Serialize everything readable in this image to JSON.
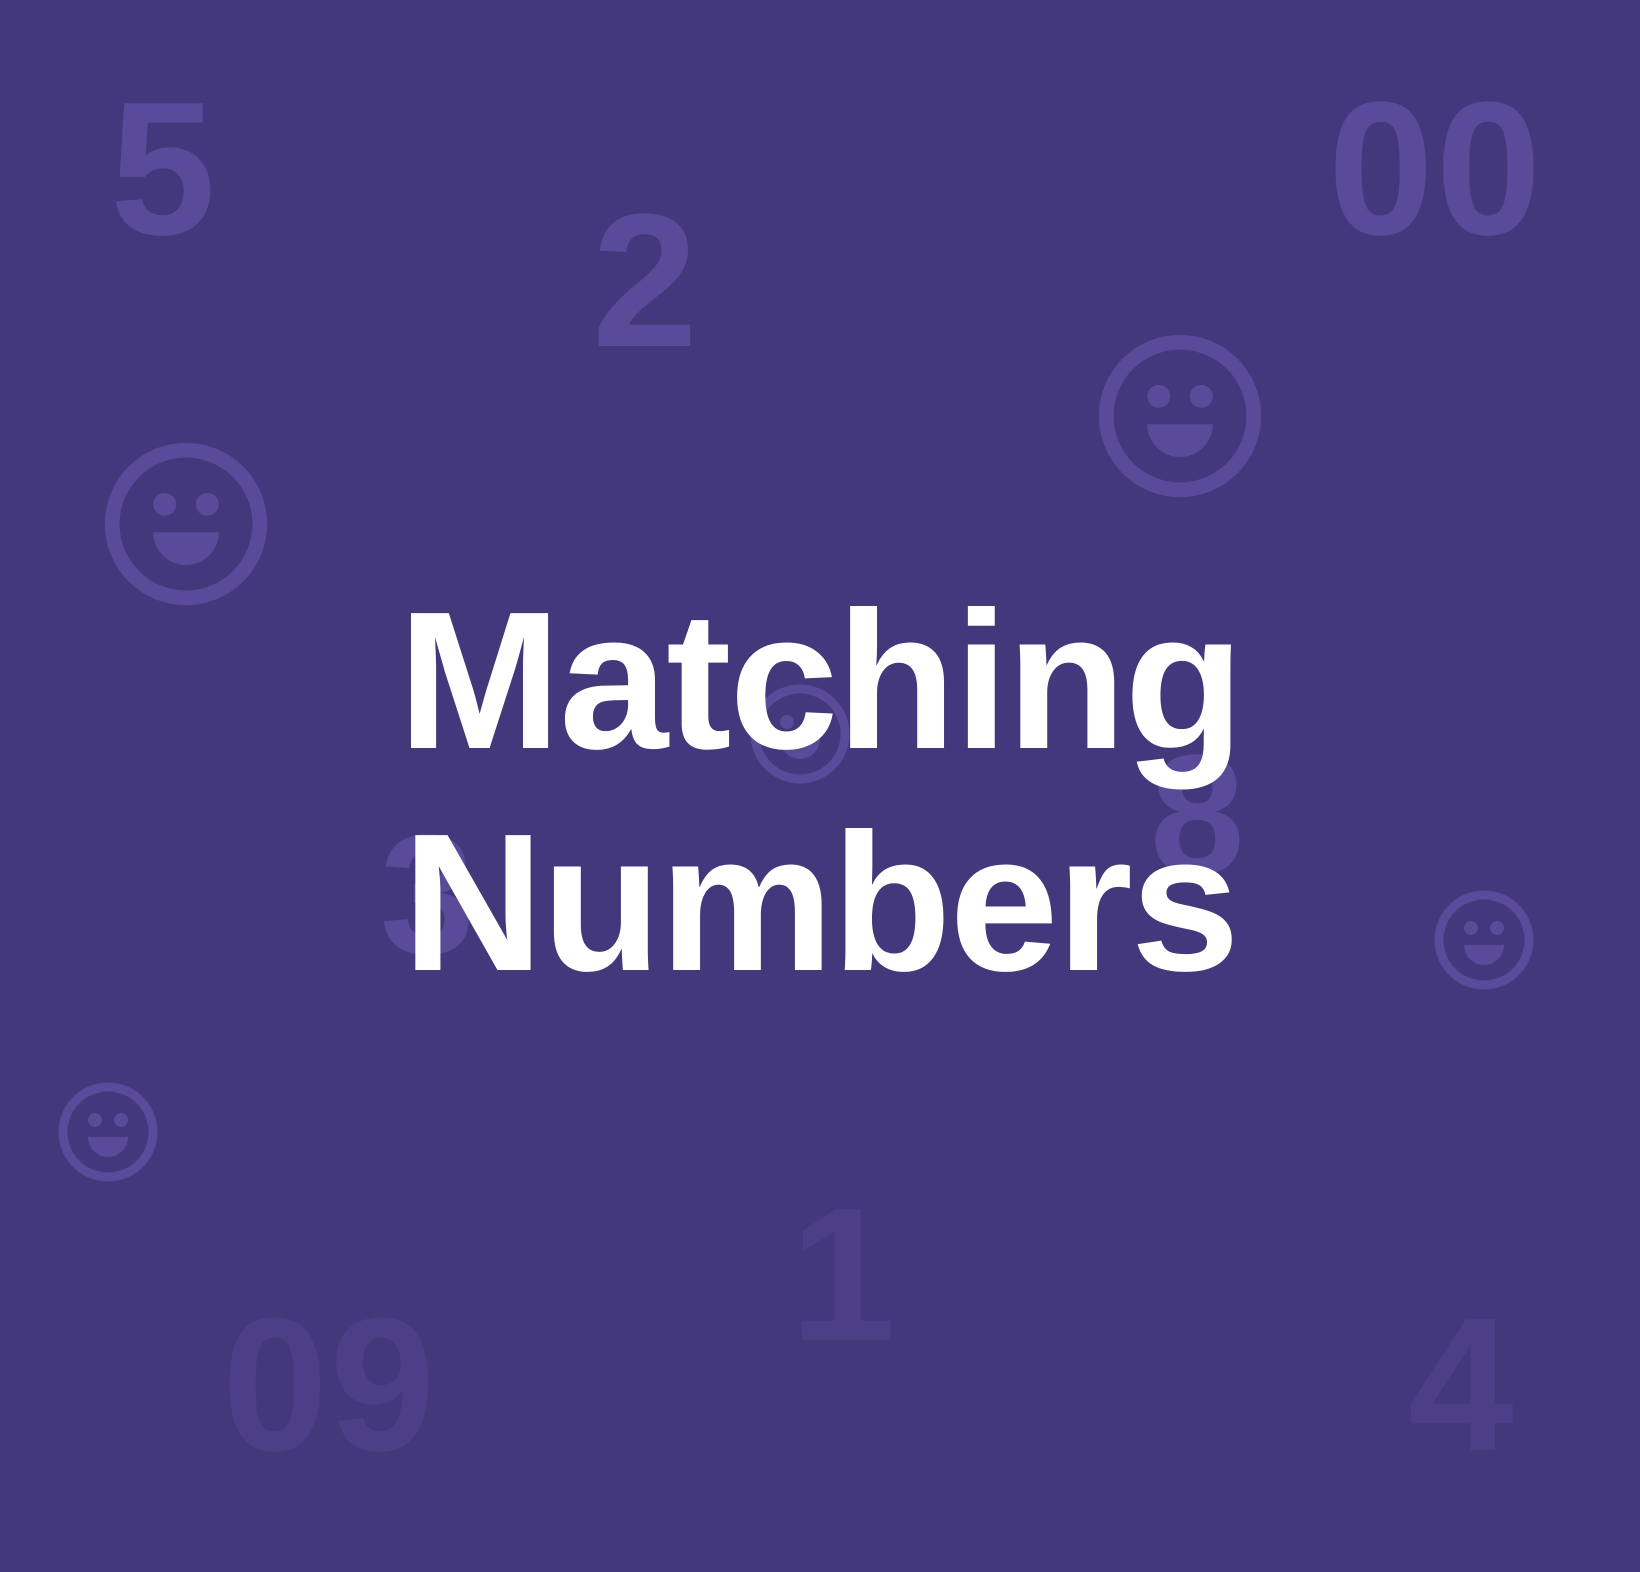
{
  "title": {
    "line1": "Matching",
    "line2": "Numbers"
  },
  "background_numbers": [
    "5",
    "2",
    "00",
    "3",
    "8",
    "1",
    "09",
    "4"
  ],
  "colors": {
    "background": "#43387c",
    "decor_strong": "#5a4a9a",
    "decor_faint": "#4c3f88",
    "title": "#ffffff"
  },
  "icons": [
    "smiley-face-icon"
  ]
}
